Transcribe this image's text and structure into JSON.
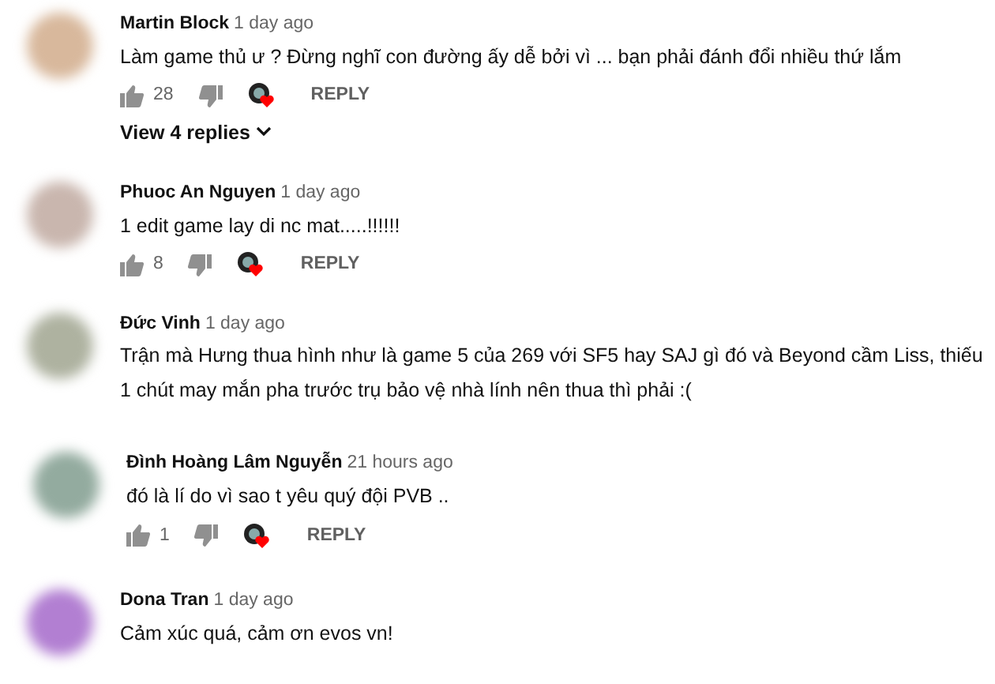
{
  "comments": [
    {
      "author": "Martin Block",
      "time": "1 day ago",
      "lines": [
        "Làm game thủ ư ? Đừng nghĩ con đường ấy dễ bởi vì ... bạn phải đánh đổi nhiều thứ lắm"
      ],
      "actions": {
        "likes": "28",
        "hearted": true,
        "reply": "REPLY"
      },
      "view_replies": "View 4 replies"
    },
    {
      "author": "Phuoc An Nguyen",
      "time": "1 day ago",
      "lines": [
        "1 edit game lay di nc mat.....!!!!!!"
      ],
      "actions": {
        "likes": "8",
        "hearted": true,
        "reply": "REPLY"
      }
    },
    {
      "author": "Đức Vinh",
      "time": "1 day ago",
      "lines": [
        "Trận mà Hưng thua hình như là game 5 của 269 với SF5 hay SAJ gì đó và Beyond cầm Liss, thiếu",
        "1 chút may mắn pha trước trụ bảo vệ nhà lính nên thua thì phải :("
      ]
    },
    {
      "author": "Đình Hoàng Lâm Nguyễn",
      "time": "21 hours ago",
      "lines": [
        "đó là lí do vì sao t yêu quý đội PVB .."
      ],
      "actions": {
        "likes": "1",
        "hearted": true,
        "reply": "REPLY"
      }
    },
    {
      "author": "Dona Tran",
      "time": "1 day ago",
      "lines": [
        "Cảm xúc quá,  cảm ơn evos vn!"
      ]
    }
  ]
}
